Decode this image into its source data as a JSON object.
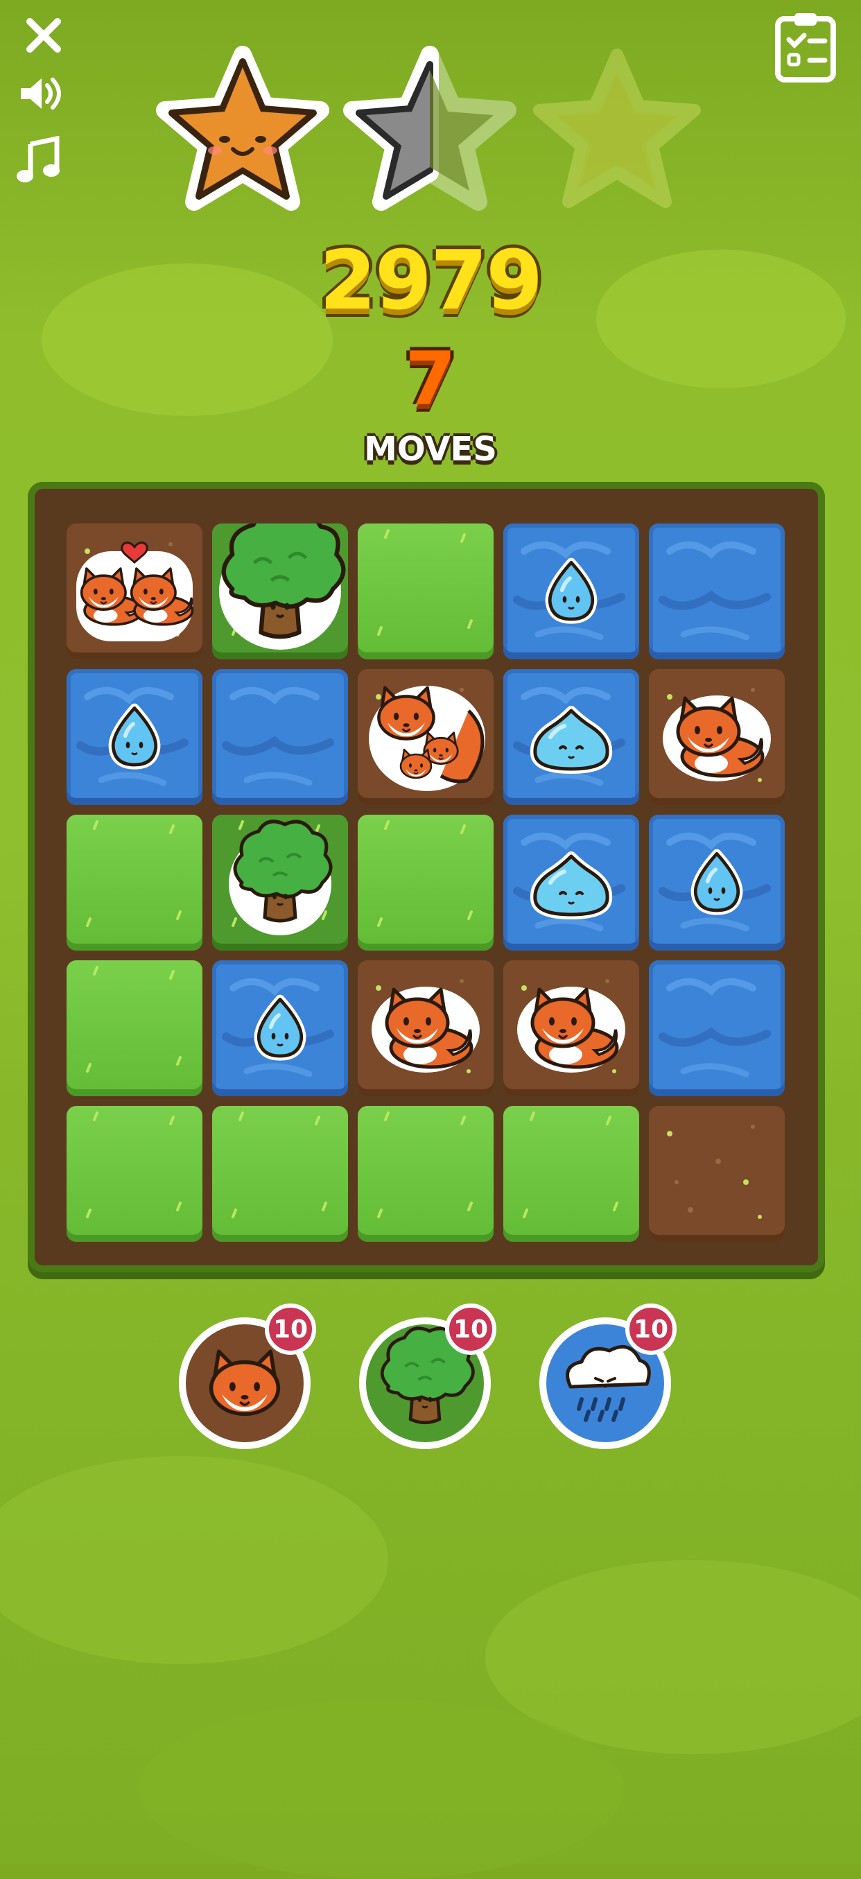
{
  "header": {
    "close_icon": "close-icon",
    "sound_icon": "sound-icon",
    "music_icon": "music-icon",
    "goals_icon": "clipboard-checklist-icon"
  },
  "stars": [
    {
      "state": "earned",
      "color": "#f0a030"
    },
    {
      "state": "half",
      "color": "#8a8a8a"
    },
    {
      "state": "empty",
      "color": "#c8d04a"
    }
  ],
  "score": "2979",
  "moves": {
    "count": "7",
    "label": "MOVES"
  },
  "board": {
    "rows": [
      [
        {
          "terrain": "dirt",
          "piece": "fox-pair"
        },
        {
          "terrain": "forest",
          "piece": "big-tree"
        },
        {
          "terrain": "grass",
          "piece": ""
        },
        {
          "terrain": "water",
          "piece": "droplet"
        },
        {
          "terrain": "water",
          "piece": ""
        }
      ],
      [
        {
          "terrain": "water",
          "piece": "droplet"
        },
        {
          "terrain": "water",
          "piece": ""
        },
        {
          "terrain": "dirt",
          "piece": "fox-family"
        },
        {
          "terrain": "water",
          "piece": "slime"
        },
        {
          "terrain": "dirt",
          "piece": "fox"
        }
      ],
      [
        {
          "terrain": "grass",
          "piece": ""
        },
        {
          "terrain": "forest",
          "piece": "tree"
        },
        {
          "terrain": "grass",
          "piece": ""
        },
        {
          "terrain": "water",
          "piece": "slime"
        },
        {
          "terrain": "water",
          "piece": "droplet"
        }
      ],
      [
        {
          "terrain": "grass",
          "piece": ""
        },
        {
          "terrain": "water",
          "piece": "droplet"
        },
        {
          "terrain": "dirt",
          "piece": "fox"
        },
        {
          "terrain": "dirt",
          "piece": "fox"
        },
        {
          "terrain": "water",
          "piece": ""
        }
      ],
      [
        {
          "terrain": "grass",
          "piece": ""
        },
        {
          "terrain": "grass",
          "piece": ""
        },
        {
          "terrain": "grass",
          "piece": ""
        },
        {
          "terrain": "grass",
          "piece": ""
        },
        {
          "terrain": "dirt",
          "piece": ""
        }
      ]
    ]
  },
  "powerups": [
    {
      "name": "fox",
      "count": "10",
      "bg": "#7a4a2a"
    },
    {
      "name": "tree",
      "count": "10",
      "bg": "#4f9a2e"
    },
    {
      "name": "rain-cloud",
      "count": "10",
      "bg": "#3c84d8"
    }
  ]
}
